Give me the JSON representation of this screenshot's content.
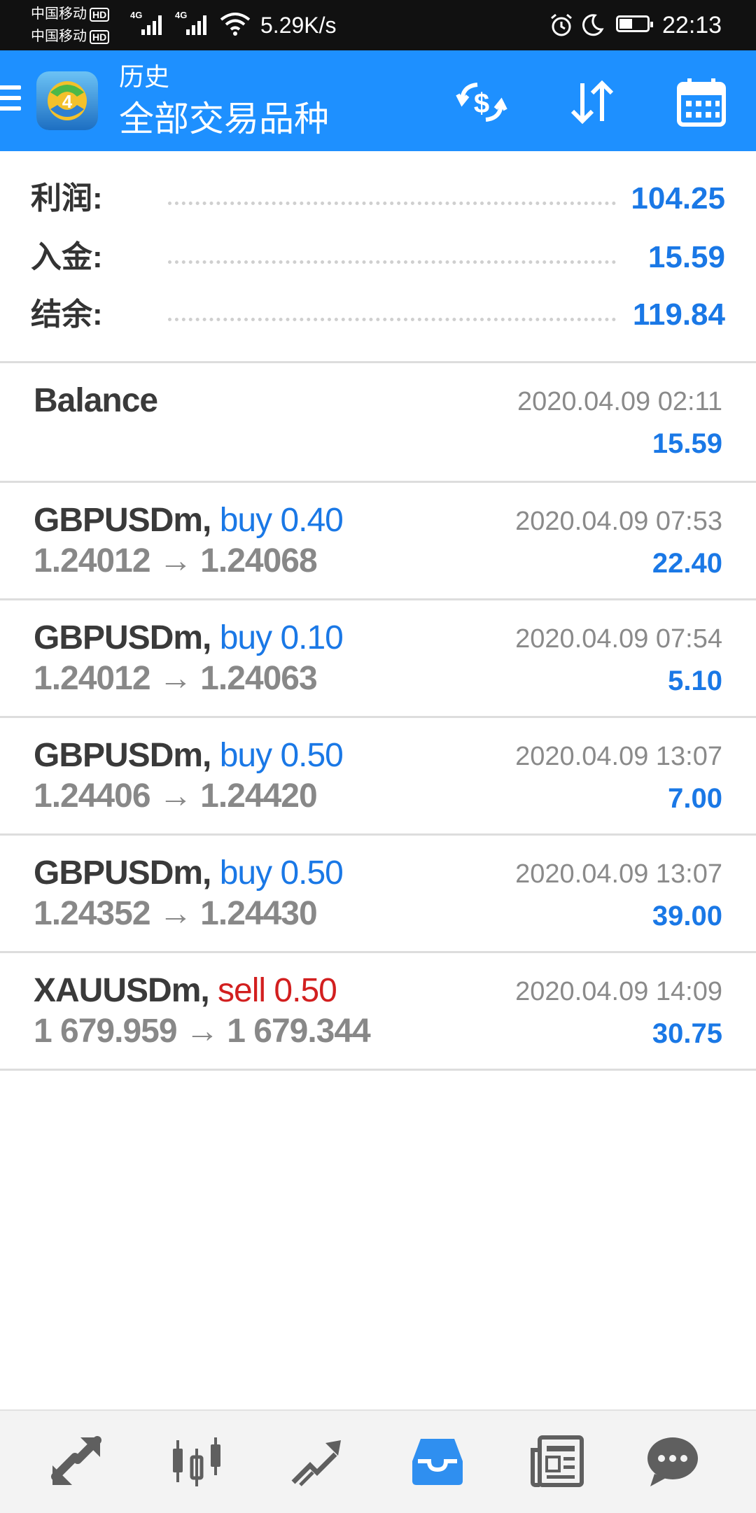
{
  "status_bar": {
    "carrier1": "中国移动",
    "carrier2": "中国移动",
    "hd_label": "HD",
    "network1": "4G",
    "network2": "4G",
    "net_speed": "5.29K/s",
    "time": "22:13"
  },
  "app_bar": {
    "subtitle": "历史",
    "title": "全部交易品种",
    "actions": [
      "currency-exchange-icon",
      "sort-icon",
      "calendar-icon"
    ]
  },
  "summary": {
    "rows": [
      {
        "label": "利润:",
        "value": "104.25"
      },
      {
        "label": "入金:",
        "value": "15.59"
      },
      {
        "label": "结余:",
        "value": "119.84"
      }
    ]
  },
  "balance_entry": {
    "title": "Balance",
    "time": "2020.04.09 02:11",
    "amount": "15.59"
  },
  "deals": [
    {
      "symbol": "GBPUSDm,",
      "type": "buy",
      "volume_label": "buy 0.40",
      "prices": "1.24012 → 1.24068",
      "time": "2020.04.09 07:53",
      "profit": "22.40"
    },
    {
      "symbol": "GBPUSDm,",
      "type": "buy",
      "volume_label": "buy 0.10",
      "prices": "1.24012 → 1.24063",
      "time": "2020.04.09 07:54",
      "profit": "5.10"
    },
    {
      "symbol": "GBPUSDm,",
      "type": "buy",
      "volume_label": "buy 0.50",
      "prices": "1.24406 → 1.24420",
      "time": "2020.04.09 13:07",
      "profit": "7.00"
    },
    {
      "symbol": "GBPUSDm,",
      "type": "buy",
      "volume_label": "buy 0.50",
      "prices": "1.24352 → 1.24430",
      "time": "2020.04.09 13:07",
      "profit": "39.00"
    },
    {
      "symbol": "XAUUSDm,",
      "type": "sell",
      "volume_label": "sell 0.50",
      "prices": "1 679.959 → 1 679.344",
      "time": "2020.04.09 14:09",
      "profit": "30.75"
    }
  ],
  "bottom_nav": {
    "items": [
      "quotes-icon",
      "chart-icon",
      "trade-icon",
      "history-icon",
      "news-icon",
      "chat-icon"
    ],
    "active": "history-icon"
  },
  "colors": {
    "accent": "#1e90ff",
    "value_blue": "#1a78e6",
    "sell_red": "#d21f1f",
    "status_bar": "#111111"
  }
}
